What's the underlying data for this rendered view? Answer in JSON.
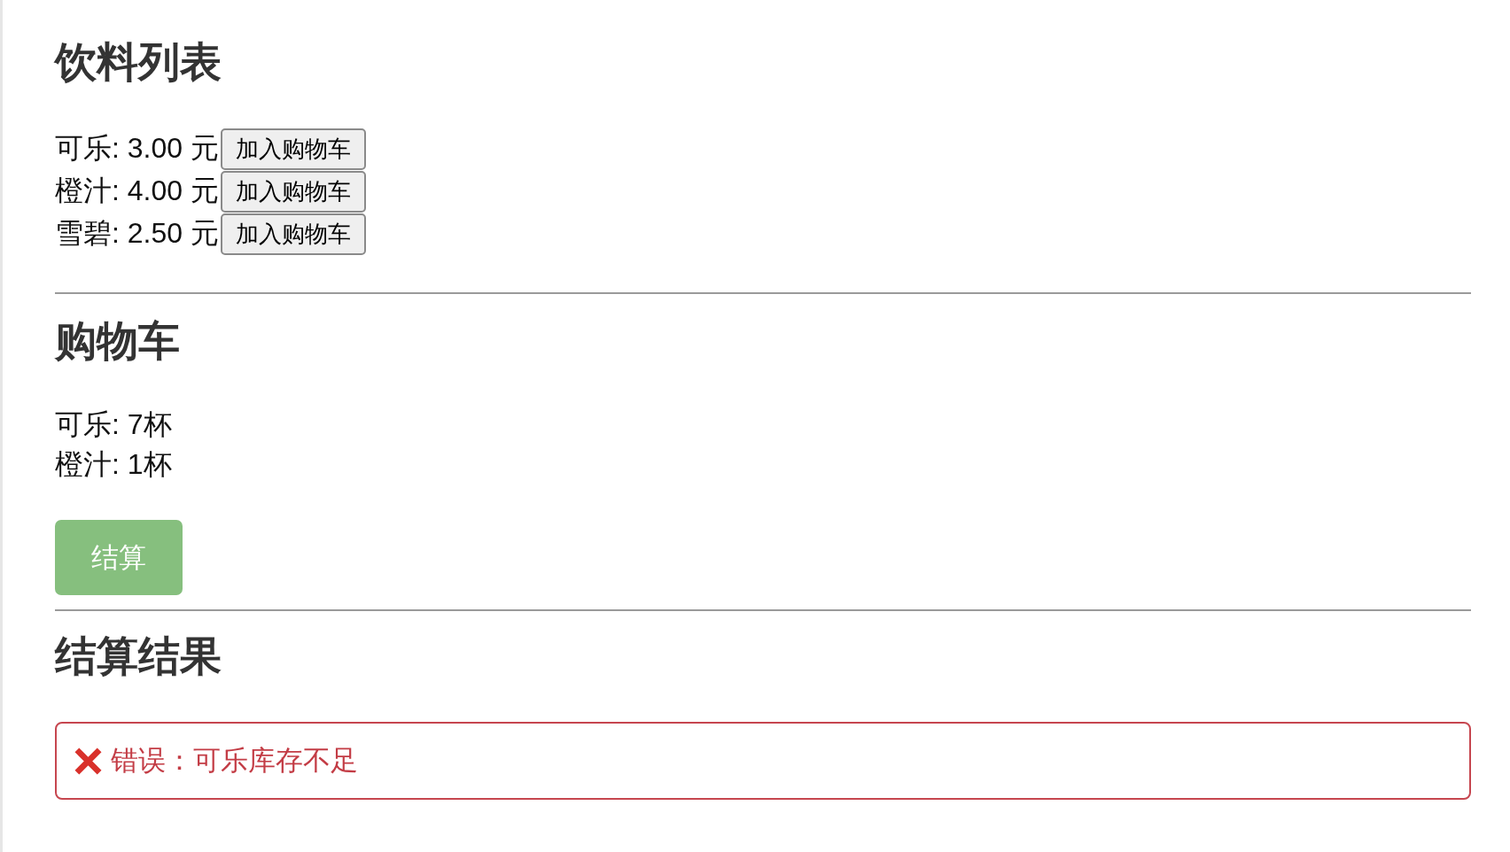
{
  "drinks": {
    "title": "饮料列表",
    "items": [
      {
        "label": "可乐: 3.00 元",
        "button": "加入购物车"
      },
      {
        "label": "橙汁: 4.00 元",
        "button": "加入购物车"
      },
      {
        "label": "雪碧: 2.50 元",
        "button": "加入购物车"
      }
    ]
  },
  "cart": {
    "title": "购物车",
    "items": [
      "可乐: 7杯",
      "橙汁: 1杯"
    ],
    "checkout_button": "结算"
  },
  "result": {
    "title": "结算结果",
    "message": {
      "kind": "error",
      "text": "错误：可乐库存不足"
    }
  }
}
